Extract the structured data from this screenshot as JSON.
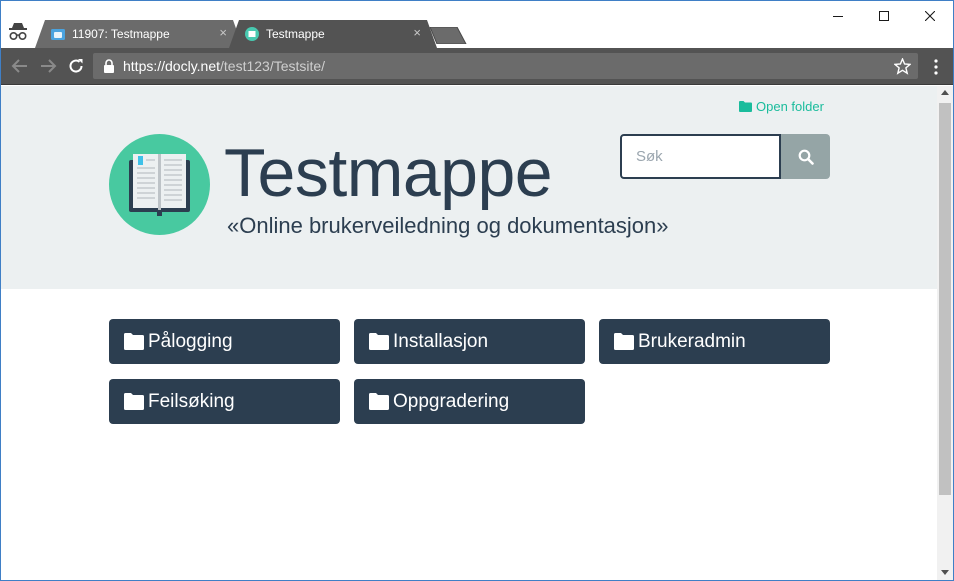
{
  "browser": {
    "tabs": [
      {
        "title": "11907: Testmappe",
        "close": "×"
      },
      {
        "title": "Testmappe",
        "close": "×"
      }
    ],
    "url_host": "https://docly.net",
    "url_path": "/test123/Testsite/"
  },
  "page": {
    "open_folder": "Open folder",
    "title": "Testmappe",
    "subtitle": "«Online brukerveiledning og dokumentasjon»",
    "search_placeholder": "Søk",
    "folders": [
      "Pålogging",
      "Installasjon",
      "Brukeradmin",
      "Feilsøking",
      "Oppgradering"
    ]
  },
  "colors": {
    "primary": "#2c3e50",
    "accent": "#1abc9c",
    "hero_bg": "#ecf0f1",
    "search_button": "#95a5a6"
  },
  "icons": [
    "incognito-icon",
    "back-icon",
    "forward-icon",
    "reload-icon",
    "lock-icon",
    "star-icon",
    "menu-icon",
    "folder-icon",
    "search-icon",
    "book-logo-icon"
  ]
}
